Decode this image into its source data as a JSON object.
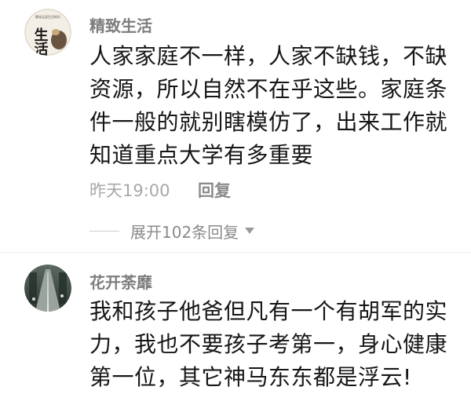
{
  "comments": [
    {
      "username": "精致生活",
      "avatar_text": "生活",
      "avatar_small_text": "静坐品读生活的乐",
      "text": "人家家庭不一样，人家不缺钱，不缺资源，所以自然不在乎这些。家庭条件一般的就别瞎模仿了，出来工作就知道重点大学有多重要",
      "time": "昨天19:00",
      "reply_label": "回复",
      "expand_label": "展开102条回复"
    },
    {
      "username": "花开荼靡",
      "avatar_icon": "road-photo-icon",
      "text": "我和孩子他爸但凡有一个有胡军的实力，我也不要孩子考第一，身心健康第一位，其它神马东东都是浮云!"
    }
  ],
  "colors": {
    "username": "#7d7d7d",
    "body_text": "#161616",
    "meta": "#a8a8a8",
    "reply": "#8a8a8a"
  }
}
